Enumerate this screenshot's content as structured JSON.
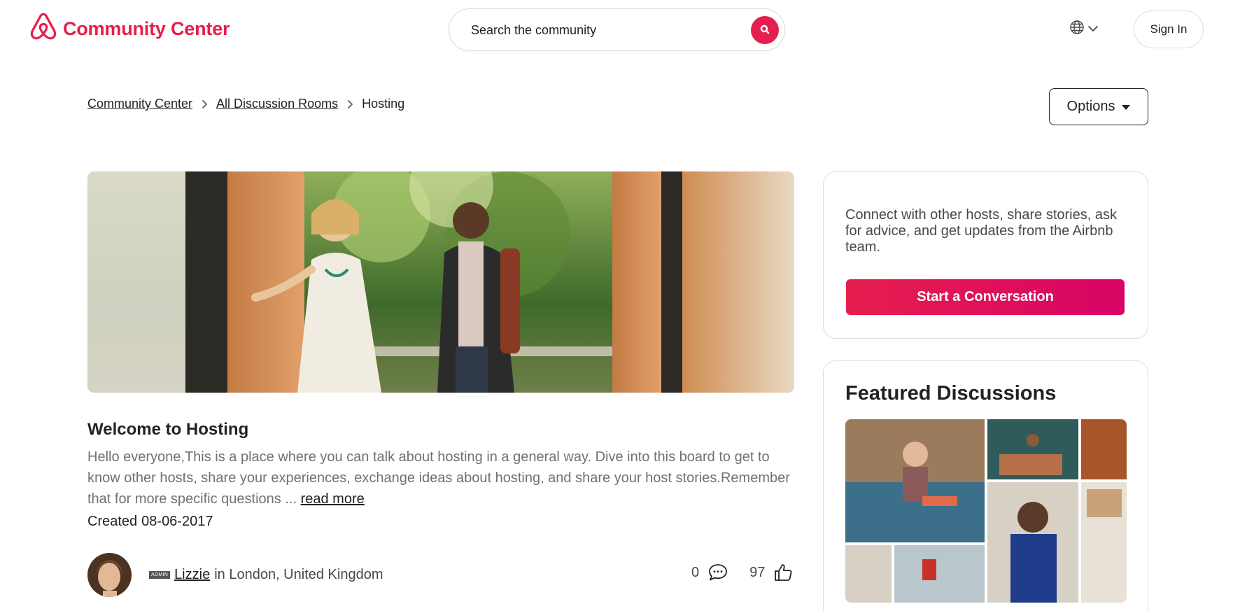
{
  "header": {
    "brand_name": "Community Center",
    "logo_icon": "airbnb-logo-icon",
    "search_placeholder": "Search the community",
    "search_icon": "search-icon",
    "language_icon": "globe-icon",
    "sign_in_label": "Sign In"
  },
  "breadcrumb": {
    "items": [
      "Community Center",
      "All Discussion Rooms"
    ],
    "current": "Hosting"
  },
  "options_label": "Options",
  "board": {
    "title": "Welcome to Hosting",
    "description": "Hello everyone,This is a place where you can talk about hosting in a general way. Dive into this board to get to know other hosts, share your experiences, exchange ideas about hosting, and share your host stories.Remember that for more specific questions ...",
    "read_more": "read more",
    "created_label": "Created",
    "created_date": "08-06-2017"
  },
  "author": {
    "badge": "ADMIN",
    "name": "Lizzie",
    "location": "in London, United Kingdom"
  },
  "stats": {
    "replies": "0",
    "likes": "97",
    "reply_icon": "speech-bubble-icon",
    "like_icon": "thumbs-up-icon"
  },
  "sidebar": {
    "intro": "Connect with other hosts, share stories, ask for advice, and get updates from the Airbnb team.",
    "start_button": "Start a Conversation",
    "featured_title": "Featured Discussions"
  },
  "colors": {
    "brand": "#e61e4d",
    "button_gradient_end": "#d70466",
    "text": "#222222",
    "muted_text": "#717171",
    "border": "#dddddd"
  }
}
